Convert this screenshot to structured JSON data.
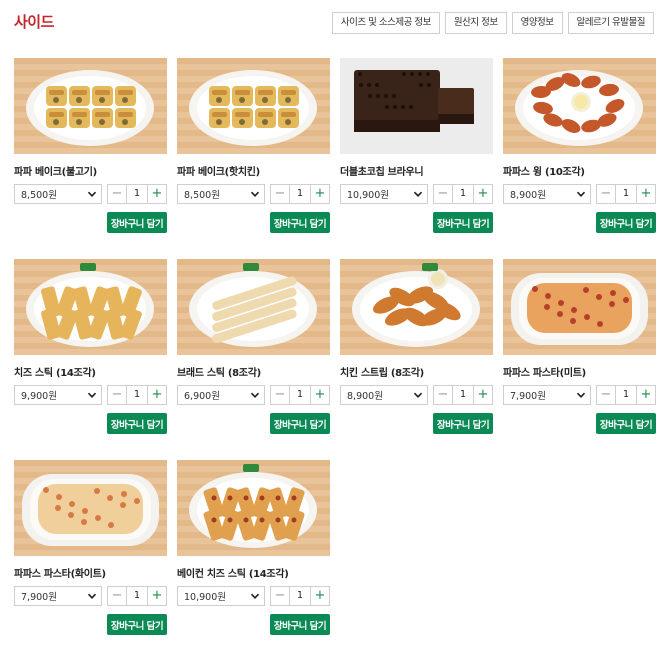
{
  "header": {
    "title": "사이드",
    "buttons": [
      "사이즈 및 소스제공 정보",
      "원산지 정보",
      "영양정보",
      "알레르기 유발물질"
    ]
  },
  "common": {
    "cart_label": "장바구니 담기",
    "minus": "−",
    "plus": "+"
  },
  "products": [
    {
      "name": "파파 베이크(불고기)",
      "price": "8,500원",
      "qty": "1",
      "image": "bake"
    },
    {
      "name": "파파 베이크(핫치킨)",
      "price": "8,500원",
      "qty": "1",
      "image": "bake"
    },
    {
      "name": "더블초코칩 브라우니",
      "price": "10,900원",
      "qty": "1",
      "image": "brownie"
    },
    {
      "name": "파파스 윙 (10조각)",
      "price": "8,900원",
      "qty": "1",
      "image": "wings"
    },
    {
      "name": "치즈 스틱 (14조각)",
      "price": "9,900원",
      "qty": "1",
      "image": "cheese-sticks"
    },
    {
      "name": "브래드 스틱 (8조각)",
      "price": "6,900원",
      "qty": "1",
      "image": "bread-sticks"
    },
    {
      "name": "치킨 스트립 (8조각)",
      "price": "8,900원",
      "qty": "1",
      "image": "chicken-strips"
    },
    {
      "name": "파파스 파스타(미트)",
      "price": "7,900원",
      "qty": "1",
      "image": "pasta-meat"
    },
    {
      "name": "파파스 파스타(화이트)",
      "price": "7,900원",
      "qty": "1",
      "image": "pasta-white"
    },
    {
      "name": "베이컨 치즈 스틱 (14조각)",
      "price": "10,900원",
      "qty": "1",
      "image": "bacon-sticks"
    }
  ]
}
